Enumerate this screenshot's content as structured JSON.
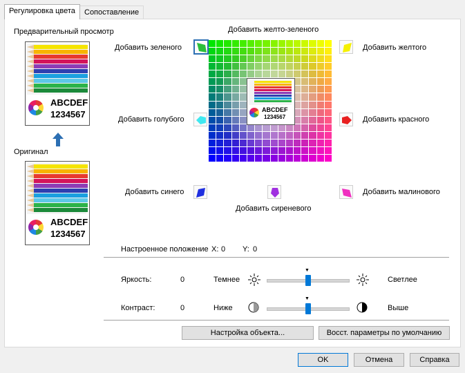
{
  "tabs": [
    "Регулировка цвета",
    "Сопоставление"
  ],
  "preview_label": "Предварительный просмотр",
  "original_label": "Оригинал",
  "sample_text": {
    "letters": "ABCDEF",
    "digits": "1234567"
  },
  "color_buttons": {
    "yellow_green": "Добавить желто-зеленого",
    "green": "Добавить зеленого",
    "yellow": "Добавить желтого",
    "cyan": "Добавить голубого",
    "red": "Добавить красного",
    "blue": "Добавить синего",
    "magenta": "Добавить малинового",
    "violet": "Добавить сиреневого"
  },
  "position": {
    "label": "Настроенное положение",
    "x_label": "X:",
    "x": "0",
    "y_label": "Y:",
    "y": "0"
  },
  "brightness": {
    "label": "Яркость:",
    "value": "0",
    "left": "Темнее",
    "right": "Светлее",
    "level": 0
  },
  "contrast": {
    "label": "Контраст:",
    "value": "0",
    "left": "Ниже",
    "right": "Выше",
    "level": 0
  },
  "buttons": {
    "object_setup": "Настройка объекта...",
    "restore_defaults": "Восст. параметры по умолчанию",
    "ok": "OK",
    "cancel": "Отмена",
    "help": "Справка"
  }
}
